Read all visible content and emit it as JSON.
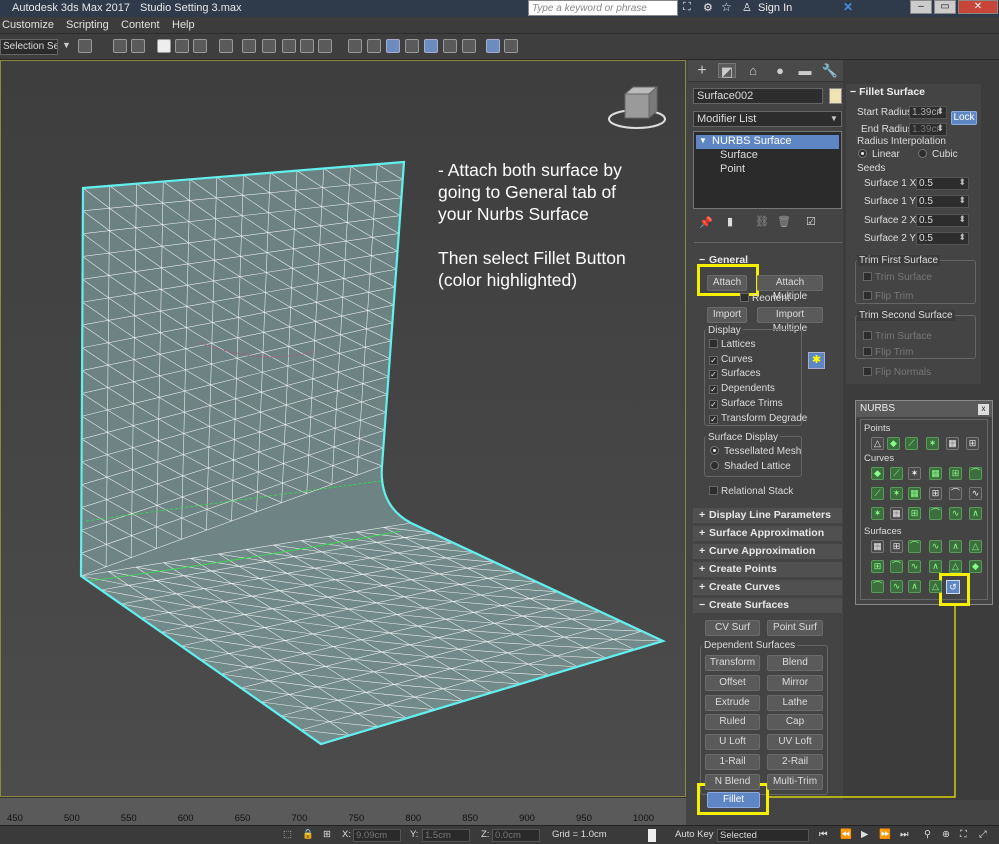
{
  "window": {
    "app_title": "Autodesk 3ds Max 2017",
    "file_name": "Studio Setting 3.max",
    "search_placeholder": "Type a keyword or phrase",
    "sign_in": "Sign In"
  },
  "menu": [
    "Customize",
    "Scripting",
    "Content",
    "Help"
  ],
  "toolbar": {
    "selection_set": "Selection Se"
  },
  "annotation": {
    "line1": "- Attach both surface by",
    "line2": "going to General tab of",
    "line3": "your Nurbs Surface",
    "line4": "Then select Fillet Button",
    "line5": "(color highlighted)"
  },
  "ruler": {
    "ticks": [
      "450",
      "500",
      "550",
      "600",
      "650",
      "700",
      "750",
      "800",
      "850",
      "900",
      "950",
      "1000"
    ]
  },
  "status": {
    "x_label": "X:",
    "x_value": "9.09cm",
    "y_label": "Y:",
    "y_value": "1.5cm",
    "z_label": "Z:",
    "z_value": "0.0cm",
    "grid": "Grid = 1.0cm",
    "auto_key": "Auto Key",
    "selected": "Selected"
  },
  "command_panel": {
    "object_name": "Surface002",
    "modifier_list": "Modifier List",
    "stack": [
      "NURBS Surface",
      "Surface",
      "Point"
    ],
    "general": {
      "title": "General",
      "attach": "Attach",
      "attach_multiple": "Attach Multiple",
      "reorient": "Reorient",
      "import": "Import",
      "import_multiple": "Import Multiple",
      "display_label": "Display",
      "display_items": [
        {
          "label": "Lattices",
          "checked": false
        },
        {
          "label": "Curves",
          "checked": true
        },
        {
          "label": "Surfaces",
          "checked": true
        },
        {
          "label": "Dependents",
          "checked": true
        },
        {
          "label": "Surface Trims",
          "checked": true
        },
        {
          "label": "Transform Degrade",
          "checked": true
        }
      ],
      "surface_display_label": "Surface Display",
      "tessellated_mesh": "Tessellated Mesh",
      "shaded_lattice": "Shaded Lattice",
      "relational_stack": "Relational Stack"
    },
    "rollouts": [
      "Display Line Parameters",
      "Surface Approximation",
      "Curve Approximation",
      "Create Points",
      "Create Curves",
      "Create Surfaces"
    ],
    "create_surfaces": {
      "cv_surf": "CV Surf",
      "point_surf": "Point Surf",
      "dependent_label": "Dependent Surfaces",
      "buttons": [
        "Transform",
        "Blend",
        "Offset",
        "Mirror",
        "Extrude",
        "Lathe",
        "Ruled",
        "Cap",
        "U Loft",
        "UV Loft",
        "1-Rail",
        "2-Rail",
        "N Blend",
        "Multi-Trim"
      ],
      "fillet": "Fillet"
    }
  },
  "fillet_surface": {
    "title": "Fillet Surface",
    "start_radius_label": "Start Radius:",
    "start_radius": "1.39cr",
    "lock": "Lock",
    "end_radius_label": "End Radius:",
    "end_radius": "1.39cr",
    "radius_interp": "Radius Interpolation",
    "linear": "Linear",
    "cubic": "Cubic",
    "seeds": "Seeds",
    "seed_items": [
      {
        "label": "Surface 1 X:",
        "value": "0.5"
      },
      {
        "label": "Surface 1 Y:",
        "value": "0.5"
      },
      {
        "label": "Surface 2 X:",
        "value": "0.5"
      },
      {
        "label": "Surface 2 Y:",
        "value": "0.5"
      }
    ],
    "trim_first": "Trim First Surface",
    "trim_second": "Trim Second Surface",
    "trim_surface": "Trim Surface",
    "flip_trim": "Flip Trim",
    "flip_normals": "Flip Normals"
  },
  "nurbs_toolbox": {
    "title": "NURBS",
    "points": "Points",
    "curves": "Curves",
    "surfaces": "Surfaces",
    "close": "x"
  }
}
